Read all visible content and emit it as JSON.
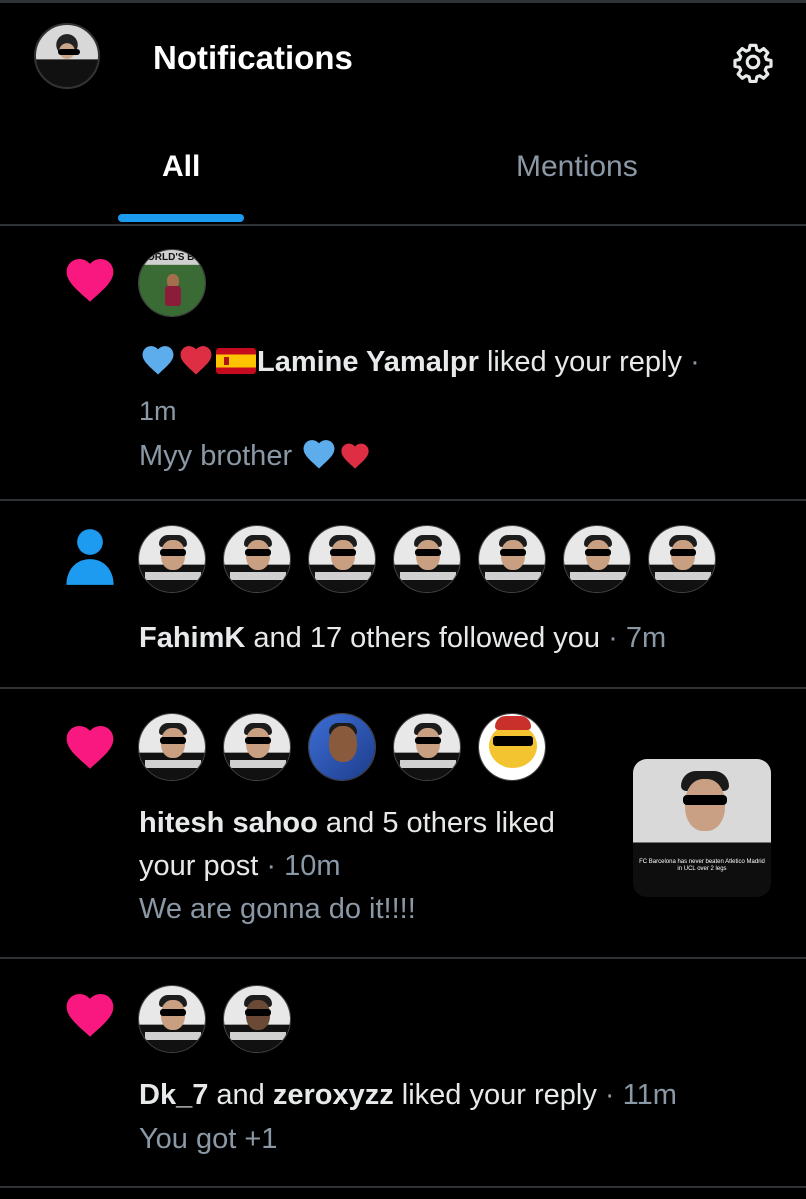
{
  "header": {
    "title": "Notifications",
    "settings_icon": "gear-icon"
  },
  "tabs": [
    {
      "label": "All",
      "active": true
    },
    {
      "label": "Mentions",
      "active": false
    }
  ],
  "colors": {
    "accent": "#1d9bf0",
    "like": "#f91880",
    "background": "#000000",
    "muted": "#8b98a5",
    "divider": "#2f3336"
  },
  "notifications": [
    {
      "type": "like",
      "type_icon": "heart-icon",
      "avatar_text": "ORLD'S BE",
      "user": "Lamine Yamalpr",
      "user_prefix_emoji": [
        "blue-heart",
        "red-heart",
        "spain-flag"
      ],
      "action": "liked your reply",
      "time": "1m",
      "snippet": "Myy brother",
      "snippet_emoji": [
        "blue-heart",
        "red-heart"
      ]
    },
    {
      "type": "follow",
      "type_icon": "person-icon",
      "avatar_count": 7,
      "user": "FahimK",
      "action": "and 17 others followed you",
      "time": "7m"
    },
    {
      "type": "like",
      "type_icon": "heart-icon",
      "avatar_count": 5,
      "user": "hitesh sahoo",
      "action_line1": "and 5 others liked",
      "action_line2": "your post",
      "time": "10m",
      "snippet": "We are gonna do it!!!!",
      "thumbnail_caption": "FC Barcelona has never beaten Atletico Madrid in UCL over 2 legs"
    },
    {
      "type": "like",
      "type_icon": "heart-icon",
      "avatar_count": 2,
      "user": "Dk_7",
      "conjunction": "and",
      "user2": "zeroxyzz",
      "action": "liked your reply",
      "time": "11m",
      "snippet": "You got +1"
    }
  ],
  "separator": "·"
}
